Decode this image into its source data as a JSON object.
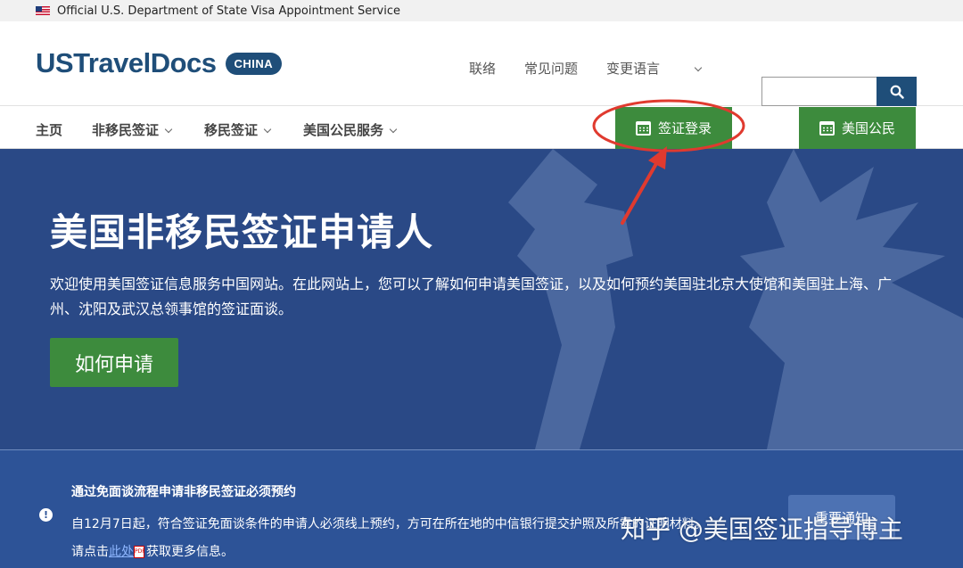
{
  "official_bar": {
    "text": "Official U.S. Department of State Visa Appointment Service"
  },
  "header": {
    "logo": "USTravelDocs",
    "badge": "CHINA",
    "links": [
      "联络",
      "常见问题",
      "变更语言"
    ],
    "search": {
      "placeholder": "",
      "value": ""
    }
  },
  "nav": {
    "items": [
      "主页",
      "非移民签证",
      "移民签证",
      "美国公民服务"
    ],
    "visa_login": "签证登录",
    "us_citizen": "美国公民"
  },
  "hero": {
    "title": "美国非移民签证申请人",
    "text": "欢迎使用美国签证信息服务中国网站。在此网站上，您可以了解如何申请美国签证，以及如何预约美国驻北京大使馆和美国驻上海、广州、沈阳及武汉总领事馆的签证面谈。",
    "button": "如何申请"
  },
  "notice": {
    "title": "通过免面谈流程申请非移民签证必须预约",
    "text_pre": "自12月7日起，符合签证免面谈条件的申请人必须线上预约，方可在所在地的中信银行提交护照及所需的证明材料。请点击",
    "link": "此处",
    "text_post": "获取更多信息。",
    "button": "重要通知"
  },
  "watermark": "知乎 @美国签证指导博主",
  "colors": {
    "brand": "#1f4e79",
    "green": "#3d8b3d",
    "hero": "#2a4986",
    "annotation": "#e03a2f"
  }
}
